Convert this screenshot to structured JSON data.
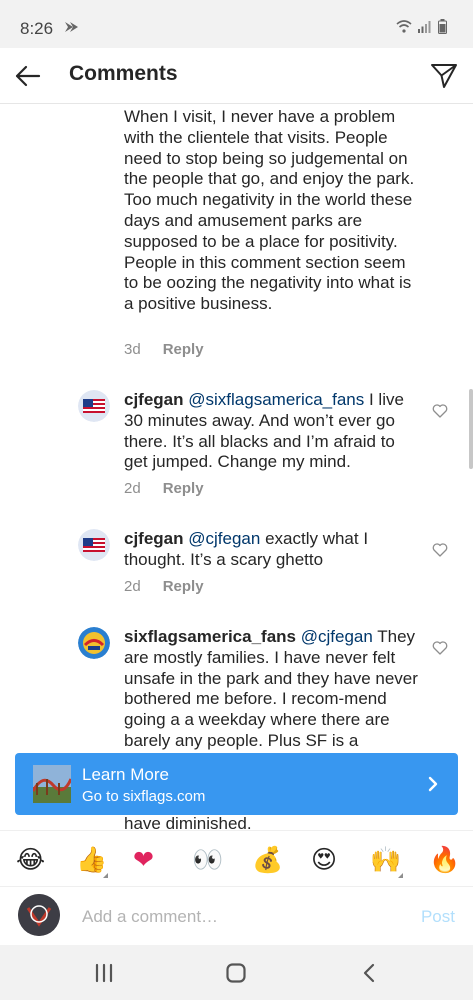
{
  "status_bar": {
    "time": "8:26",
    "colors": {
      "icons": "#666666"
    }
  },
  "header": {
    "title": "Comments",
    "back_icon": "arrow-left-icon",
    "send_icon": "paper-plane-icon"
  },
  "comments": [
    {
      "username": "",
      "mention": "",
      "text": "When I visit, I never have a problem with the clientele that visits. People need to stop being so judgemental on the people that go, and enjoy the park. Too much negativity in the world these days and amusement parks are supposed to be a place for positivity. People in this comment section seem to be oozing the negativity into what is a positive business.",
      "age": "3d",
      "reply": "Reply"
    },
    {
      "username": "cjfegan",
      "mention": "@sixflagsamerica_fans",
      "text": " I live 30 minutes away. And won’t ever go there. It’s all blacks and I’m afraid to get jumped. Change my mind.",
      "age": "2d",
      "reply": "Reply"
    },
    {
      "username": "cjfegan",
      "mention": "@cjfegan",
      "text": " exactly what I thought. It’s a scary ghetto",
      "age": "2d",
      "reply": "Reply"
    },
    {
      "username": "sixflagsamerica_fans",
      "mention": "@cjfegan",
      "text": " They are mostly families. I have never felt unsafe in the park and they have never bothered me before. I recom-mend going a a weekday where there are barely any people. Plus SF is a",
      "tail": "have diminished."
    }
  ],
  "banner": {
    "title": "Learn More",
    "subtitle": "Go to sixflags.com",
    "color": "#3897f0"
  },
  "emoji_bar": [
    "😂",
    "👍",
    "❤",
    "👀",
    "💰",
    "😍",
    "🙌",
    "🔥"
  ],
  "composer": {
    "placeholder": "Add a comment…",
    "post": "Post",
    "post_color": "#b2dffc"
  },
  "nav_bar": {
    "icons": [
      "recent-apps-icon",
      "home-icon",
      "back-icon"
    ]
  }
}
